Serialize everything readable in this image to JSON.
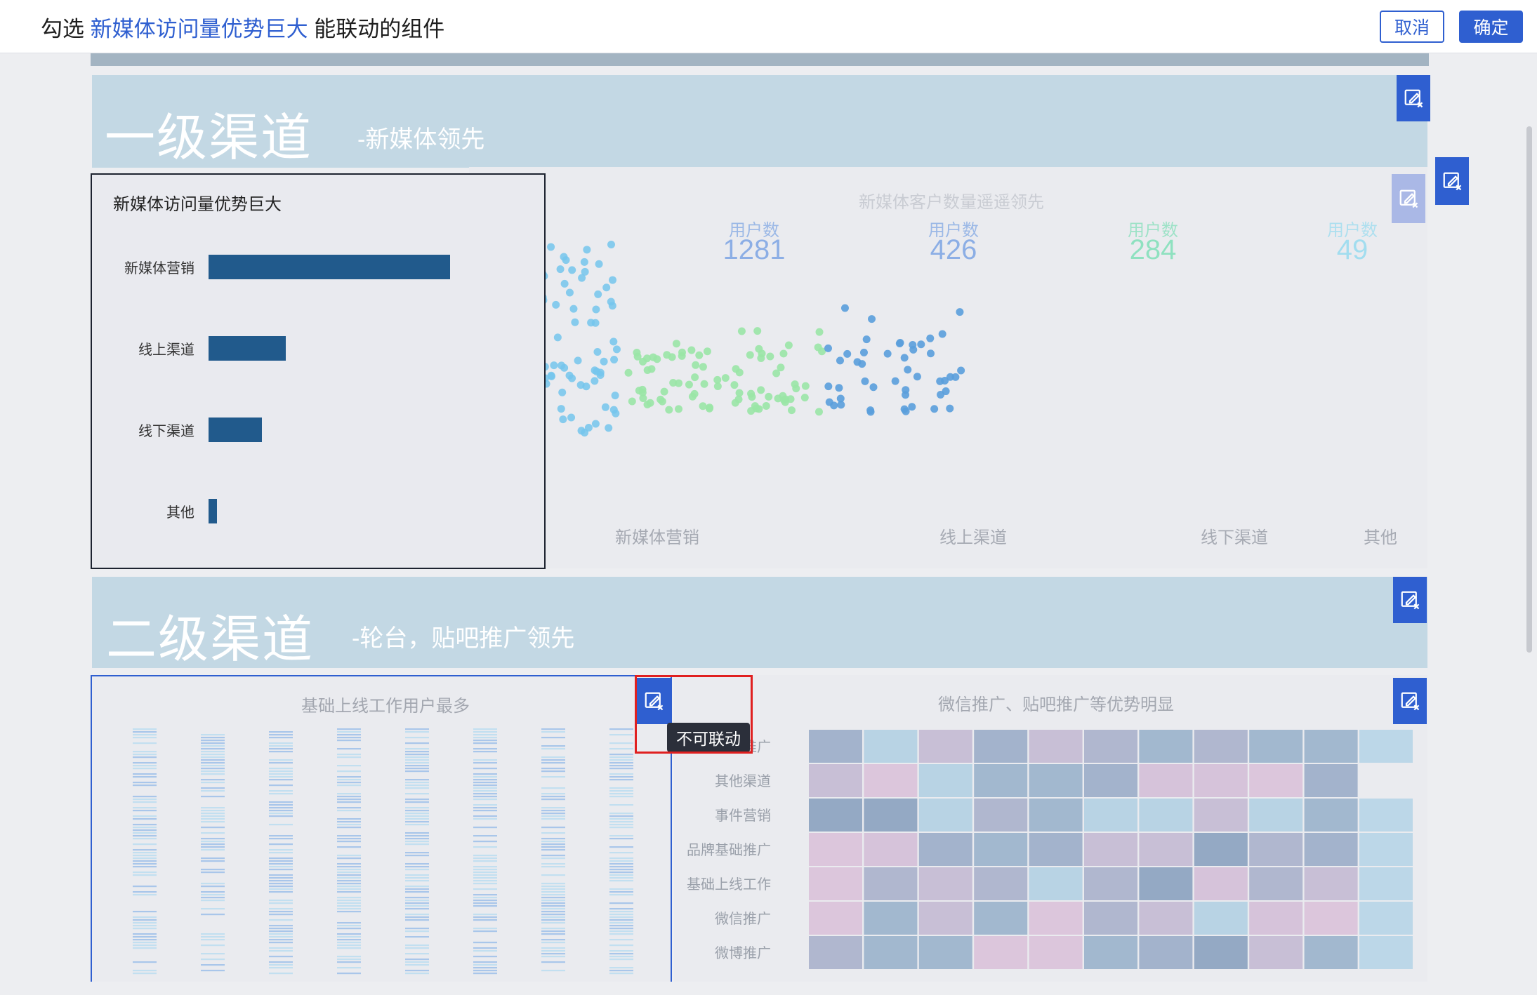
{
  "header": {
    "prefix": "勾选",
    "highlight": "新媒体访问量优势巨大",
    "suffix": "能联动的组件",
    "cancel_label": "取消",
    "confirm_label": "确定"
  },
  "section1": {
    "title": "一级渠道",
    "subtitle": "-新媒体领先"
  },
  "section2": {
    "title": "二级渠道",
    "subtitle": "-轮台，贴吧推广领先"
  },
  "bar_panel": {
    "title": "新媒体访问量优势巨大",
    "chart_data": {
      "type": "bar",
      "orientation": "horizontal",
      "categories": [
        "新媒体营销",
        "线上渠道",
        "线下渠道",
        "其他"
      ],
      "values": [
        100,
        32,
        22,
        3
      ],
      "color": "#215a8c"
    }
  },
  "scatter_panel": {
    "title": "新媒体客户数量遥遥领先",
    "stats": [
      {
        "label": "用户数",
        "value": "1281",
        "color": "#5b8fe0"
      },
      {
        "label": "用户数",
        "value": "426",
        "color": "#5b8fe0"
      },
      {
        "label": "用户数",
        "value": "284",
        "color": "#5fdca8"
      },
      {
        "label": "用户数",
        "value": "49",
        "color": "#7dd7f0"
      }
    ],
    "categories": [
      {
        "label": "新媒体营销",
        "count": 1281,
        "color": "#74c6ec"
      },
      {
        "label": "线上渠道",
        "count": 426,
        "color": "#9ae6a6"
      },
      {
        "label": "线下渠道",
        "count": 284,
        "color": "#5a9fdc"
      },
      {
        "label": "其他",
        "count": 49,
        "color": "#7fd3e8"
      }
    ]
  },
  "strip_panel": {
    "title": "基础上线工作用户最多",
    "columns": 8
  },
  "heatmap_panel": {
    "title": "微信推广、贴吧推广等优势明显",
    "rows": [
      "贴吧推广",
      "其他渠道",
      "事件营销",
      "品牌基础推广",
      "基础上线工作",
      "微信推广",
      "微博推广"
    ],
    "colors": [
      "#d6c3da",
      "#b0b7cf",
      "#a3b3cc",
      "#c8bfd6",
      "#a2b8cf",
      "#b8d3e4",
      "#94a9c4",
      "#dcc6dc"
    ]
  },
  "tooltip": {
    "text": "不可联动"
  },
  "icons": {
    "edit": "edit-link-icon"
  }
}
